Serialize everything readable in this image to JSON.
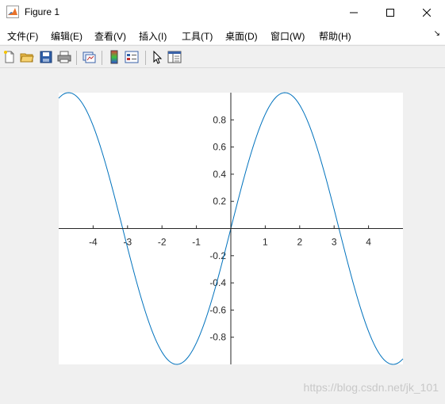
{
  "window": {
    "title": "Figure 1"
  },
  "menu": {
    "items": [
      {
        "label": "文件(F)",
        "name": "menu-file"
      },
      {
        "label": "编辑(E)",
        "name": "menu-edit"
      },
      {
        "label": "查看(V)",
        "name": "menu-view"
      },
      {
        "label": "插入(I)",
        "name": "menu-insert"
      },
      {
        "label": "工具(T)",
        "name": "menu-tools"
      },
      {
        "label": "桌面(D)",
        "name": "menu-desktop"
      },
      {
        "label": "窗口(W)",
        "name": "menu-window"
      },
      {
        "label": "帮助(H)",
        "name": "menu-help"
      }
    ]
  },
  "toolbar": {
    "buttons": [
      {
        "icon": "new-file-icon"
      },
      {
        "icon": "open-folder-icon"
      },
      {
        "icon": "save-icon"
      },
      {
        "icon": "print-icon"
      },
      {
        "icon": "link-plot-icon"
      },
      {
        "icon": "colorbar-icon"
      },
      {
        "icon": "legend-icon"
      },
      {
        "icon": "pointer-icon"
      },
      {
        "icon": "property-editor-icon"
      }
    ]
  },
  "chart_data": {
    "type": "line",
    "function": "sin(x)",
    "xlim": [
      -5,
      5
    ],
    "ylim": [
      -1,
      1
    ],
    "x_ticks": [
      -4,
      -3,
      -2,
      -1,
      1,
      2,
      3,
      4
    ],
    "y_ticks": [
      0.8,
      0.6,
      0.4,
      0.2,
      -0.2,
      -0.4,
      -0.6,
      -0.8
    ],
    "x_tick_labels": [
      "-4",
      "-3",
      "-2",
      "-1",
      "1",
      "2",
      "3",
      "4"
    ],
    "y_tick_labels": [
      "0.8",
      "0.6",
      "0.4",
      "0.2",
      "-0.2",
      "-0.4",
      "-0.6",
      "-0.8"
    ],
    "series": [
      {
        "color": "#0072bd",
        "x_range": [
          -5,
          5
        ],
        "samples": 201
      }
    ],
    "axis_location": "origin",
    "grid": false,
    "legend": "none"
  },
  "watermark": "https://blog.csdn.net/jk_101"
}
